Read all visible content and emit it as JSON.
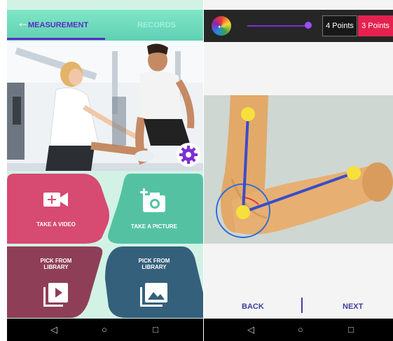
{
  "left_screen": {
    "header": {
      "back_icon": "arrow-left",
      "tabs": [
        {
          "label": "MEASUREMENT",
          "active": true
        },
        {
          "label": "RECORDS",
          "active": false
        }
      ]
    },
    "settings_icon": "gear-icon",
    "tiles": [
      {
        "label": "TAKE A VIDEO",
        "icon": "video-camera-icon",
        "color": "#d74a71"
      },
      {
        "label": "TAKE A PICTURE",
        "icon": "add-photo-icon",
        "color": "#54c2a2"
      },
      {
        "label": "PICK FROM\nLIBRARY",
        "icon": "video-library-icon",
        "color": "#8e3f57"
      },
      {
        "label": "PICK FROM\nLIBRARY",
        "icon": "photo-library-icon",
        "color": "#35607c"
      }
    ]
  },
  "right_screen": {
    "toolbar": {
      "logo_icon": "color-wheel-back-icon",
      "buttons": [
        "4 Points",
        "3 Points"
      ],
      "selected": "3 Points"
    },
    "footer": {
      "back_label": "BACK",
      "next_label": "NEXT"
    }
  },
  "nav_bar": {
    "icons": [
      "back-triangle-icon",
      "home-circle-icon",
      "recents-square-icon"
    ]
  },
  "colors": {
    "accent": "#5a2cc4",
    "mint": "#7fe6c6",
    "pink": "#e5224f",
    "measure_line": "#3b4cc9",
    "joint": "#f7e03c"
  }
}
